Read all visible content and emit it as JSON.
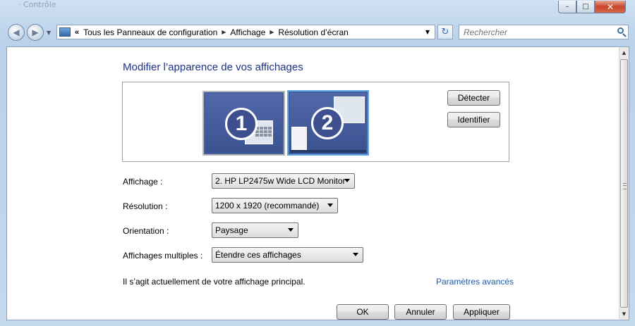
{
  "window": {
    "ghost_title": "· Contrôle",
    "controls": {
      "minimize": "–",
      "maximize": "□",
      "close": "✕"
    }
  },
  "nav": {
    "back_icon": "arrow-left",
    "forward_icon": "arrow-right",
    "history_icon": "chevron-down"
  },
  "address": {
    "lead": "«",
    "crumbs": [
      "Tous les Panneaux de configuration",
      "Affichage",
      "Résolution d’écran"
    ],
    "separator": "▶",
    "dropdown": "▼"
  },
  "refresh_icon": "↻",
  "search": {
    "placeholder": "Rechercher"
  },
  "page": {
    "heading": "Modifier l’apparence de vos affichages",
    "monitors": [
      {
        "number": "1",
        "selected": false
      },
      {
        "number": "2",
        "selected": true
      }
    ],
    "detect_button": "Détecter",
    "identify_button": "Identifier",
    "fields": {
      "display": {
        "label": "Affichage :",
        "value": "2. HP LP2475w Wide LCD Monitor"
      },
      "resolution": {
        "label": "Résolution :",
        "value": "1200 x 1920 (recommandé)"
      },
      "orientation": {
        "label": "Orientation :",
        "value": "Paysage"
      },
      "multiple": {
        "label": "Affichages multiples :",
        "value": "Étendre ces affichages"
      }
    },
    "info_text": "Il s’agit actuellement de votre affichage principal.",
    "advanced_link": "Paramètres avancés",
    "buttons": {
      "ok": "OK",
      "cancel": "Annuler",
      "apply": "Appliquer"
    }
  },
  "colors": {
    "heading": "#1e3287",
    "link": "#1e5aa8",
    "monitor_selected_border": "#61a8e0"
  }
}
